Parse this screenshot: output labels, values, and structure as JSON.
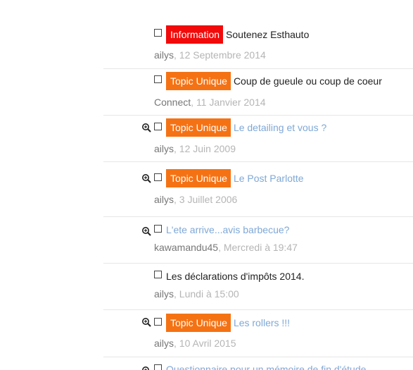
{
  "colors": {
    "information_badge": "#f20a0a",
    "topic_unique_badge": "#f57214",
    "read_link": "#7fa8d6",
    "unread_link": "#222222",
    "author": "#777777",
    "date": "#b5b5b5"
  },
  "topics": [
    {
      "badge": "Information",
      "title": "Soutenez Esthauto",
      "author": "ailys",
      "date": "12 Septembre 2014",
      "read": false,
      "preview_icon": false
    },
    {
      "badge": "Topic Unique",
      "title": "Coup de gueule ou coup de coeur",
      "author": "Connect",
      "date": "11 Janvier 2014",
      "read": false,
      "preview_icon": false
    },
    {
      "badge": "Topic Unique",
      "title": "Le detailing et vous ?",
      "author": "ailys",
      "date": "12 Juin 2009",
      "read": true,
      "preview_icon": true
    },
    {
      "badge": "Topic Unique",
      "title": "Le Post Parlotte",
      "author": "ailys",
      "date": "3 Juillet 2006",
      "read": true,
      "preview_icon": true
    },
    {
      "badge": "",
      "title": "L'ete arrive...avis barbecue?",
      "author": "kawamandu45",
      "date": "Mercredi à 19:47",
      "read": true,
      "preview_icon": true
    },
    {
      "badge": "",
      "title": "Les déclarations d'impôts 2014.",
      "author": "ailys",
      "date": "Lundi à 15:00",
      "read": false,
      "preview_icon": false
    },
    {
      "badge": "Topic Unique",
      "title": "Les rollers !!!",
      "author": "ailys",
      "date": "10 Avril 2015",
      "read": true,
      "preview_icon": true
    },
    {
      "badge": "",
      "title": "Questionnaire pour un mémoire de fin d'étude",
      "author": "",
      "date": "",
      "read": true,
      "preview_icon": true
    }
  ]
}
